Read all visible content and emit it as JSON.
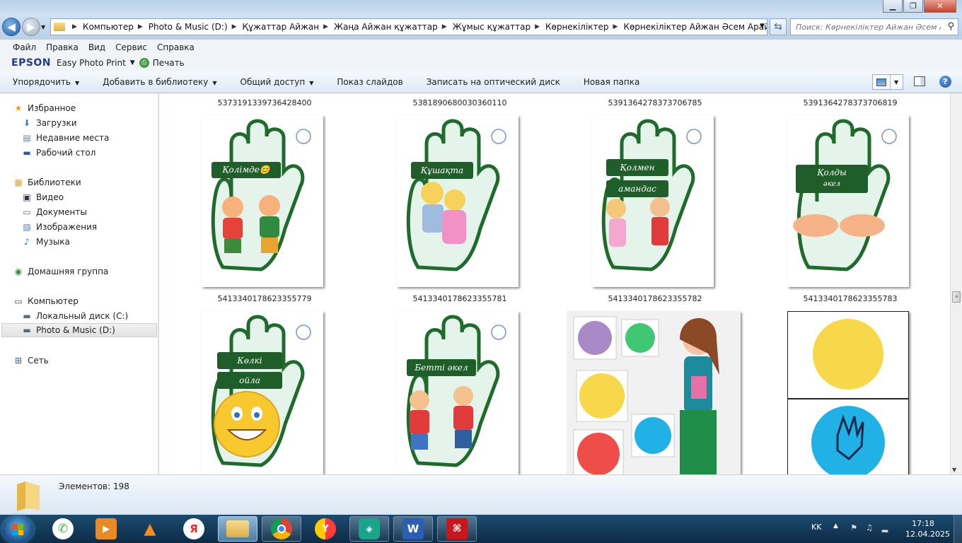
{
  "window": {
    "minimize": "▁",
    "maximize": "❐",
    "close": "✕"
  },
  "address": {
    "path": [
      "Компьютер",
      "Photo & Music (D:)",
      "Құжаттар Айжан",
      "Жаңа Айжан құжаттар",
      "Жұмыс құжаттар",
      "Көрнекіліктер",
      "Көрнекіліктер Айжан Әсем Арай"
    ],
    "search_placeholder": "Поиск: Көрнекіліктер Айжан Әсем Арай"
  },
  "menu": [
    "Файл",
    "Правка",
    "Вид",
    "Сервис",
    "Справка"
  ],
  "epson": {
    "logo": "EPSON",
    "app": "Easy Photo Print",
    "print": "Печать"
  },
  "toolbar": {
    "organize": "Упорядочить",
    "library": "Добавить в библиотеку",
    "share": "Общий доступ",
    "slideshow": "Показ слайдов",
    "burn": "Записать на оптический диск",
    "newfolder": "Новая папка"
  },
  "nav": {
    "favorites": "Избранное",
    "downloads": "Загрузки",
    "recent": "Недавние места",
    "desktop": "Рабочий стол",
    "libraries": "Библиотеки",
    "video": "Видео",
    "documents": "Документы",
    "images": "Изображения",
    "music": "Музыка",
    "homegroup": "Домашняя группа",
    "computer": "Компьютер",
    "disk_c": "Локальный диск (C:)",
    "disk_d": "Photo & Music (D:)",
    "network": "Сеть"
  },
  "files": [
    {
      "name": "5373191339736428400",
      "label": "Қолімде😊",
      "label2": ""
    },
    {
      "name": "5381890680030360110",
      "label": "Құшақта",
      "label2": ""
    },
    {
      "name": "5391364278373706785",
      "label": "Қолмен",
      "label2": "амандас"
    },
    {
      "name": "5391364278373706819",
      "label": "Қолды",
      "label2": "әкел"
    },
    {
      "name": "5413340178623355779",
      "label": "Көлкі",
      "label2": "ойла"
    },
    {
      "name": "5413340178623355781",
      "label": "Бетті әкел",
      "label2": ""
    },
    {
      "name": "5413340178623355782",
      "label": "",
      "label2": ""
    },
    {
      "name": "5413340178623355783",
      "label": "",
      "label2": ""
    }
  ],
  "status": {
    "count": "Элементов: 198"
  },
  "taskbar": {
    "lang": "KK",
    "time": "17:18",
    "date": "12.04.2025",
    "apps": [
      "whatsapp-icon",
      "media-player-icon",
      "vlc-icon",
      "yandex-icon",
      "explorer-icon",
      "chrome-icon",
      "yandex-browser-icon",
      "app-icon",
      "word-icon",
      "acrobat-icon"
    ],
    "yandex_letter": "Я",
    "word_letter": "W"
  },
  "colors": {
    "hand_green": "#1e6b2c",
    "hand_fill": "#e5f4ea",
    "badge_green": "#1f5e2b",
    "taskbar": "#173d5e"
  }
}
